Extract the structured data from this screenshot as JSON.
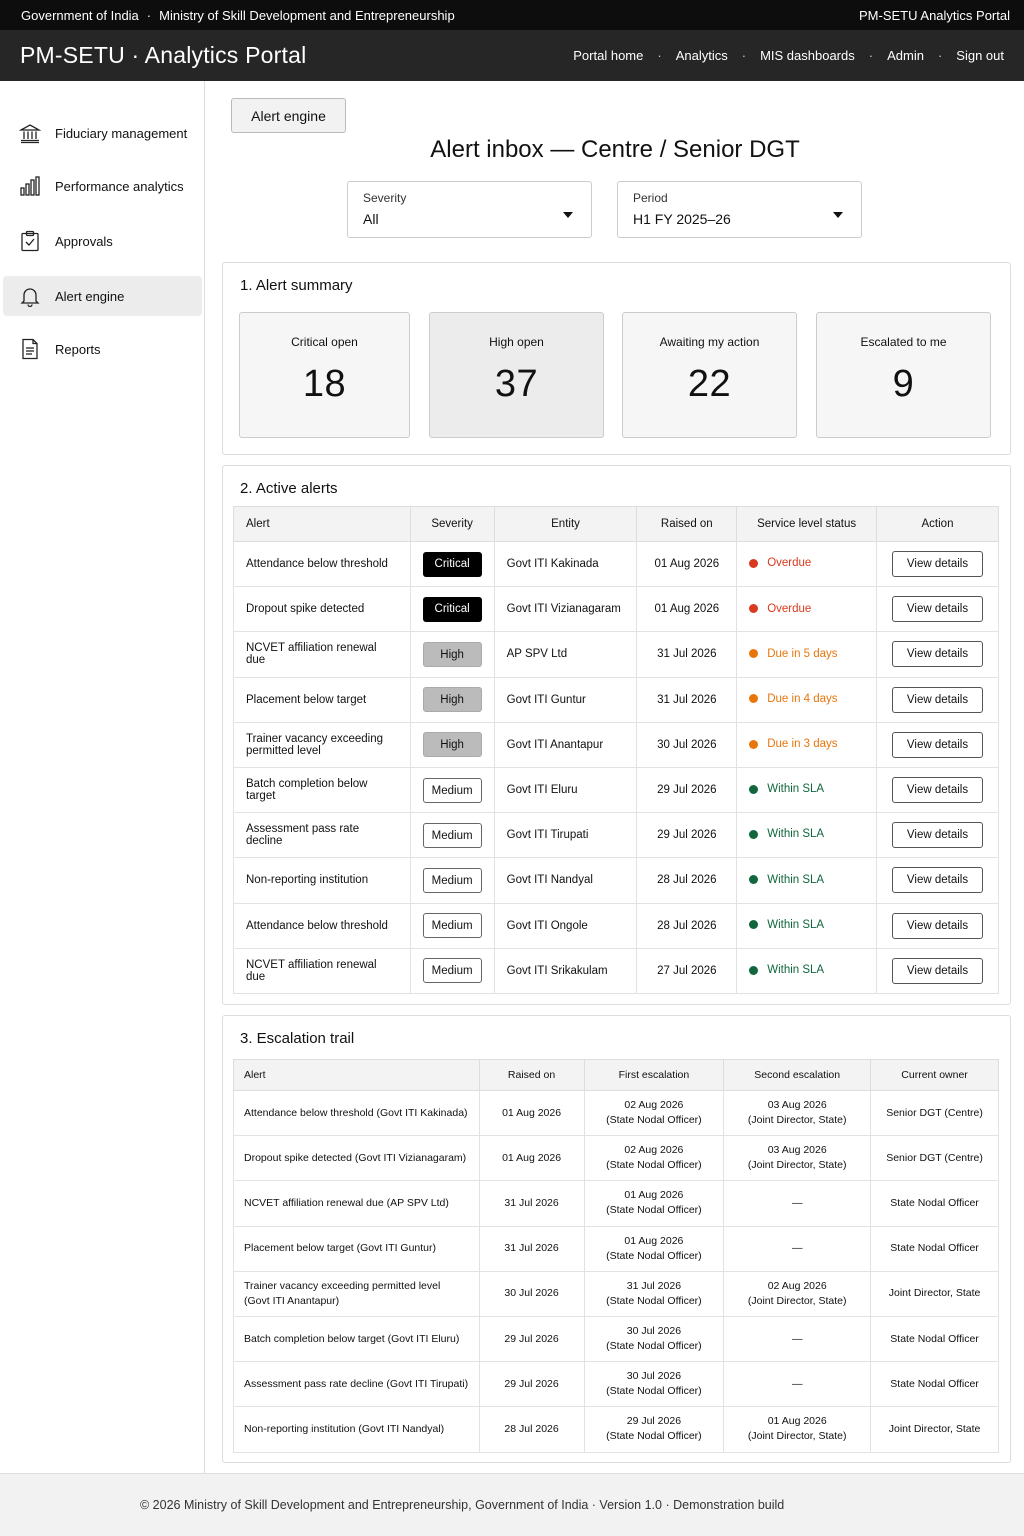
{
  "topbar": {
    "gov": "Government of India",
    "sep": "·",
    "ministry": "Ministry of Skill Development and Entrepreneurship",
    "right": "PM-SETU Analytics Portal"
  },
  "header": {
    "brand": "PM-SETU · Analytics Portal",
    "nav": [
      "Portal home",
      "Analytics",
      "MIS dashboards",
      "Admin",
      "Sign out"
    ],
    "nav_sep": "·"
  },
  "sidebar": {
    "items": [
      {
        "label": "Fiduciary management",
        "icon": "bank-icon"
      },
      {
        "label": "Performance analytics",
        "icon": "bar-chart-icon"
      },
      {
        "label": "Approvals",
        "icon": "clipboard-check-icon"
      },
      {
        "label": "Alert engine",
        "icon": "bell-icon",
        "active": true
      },
      {
        "label": "Reports",
        "icon": "document-icon"
      }
    ]
  },
  "main": {
    "button": "Alert engine",
    "title": "Alert inbox — Centre / Senior DGT",
    "filters": {
      "severity": {
        "label": "Severity",
        "value": "All"
      },
      "period": {
        "label": "Period",
        "value": "H1 FY 2025–26"
      }
    }
  },
  "summary": {
    "heading": "1.  Alert summary",
    "cards": [
      {
        "label": "Critical open",
        "value": "18"
      },
      {
        "label": "High open",
        "value": "37"
      },
      {
        "label": "Awaiting my action",
        "value": "22"
      },
      {
        "label": "Escalated to me",
        "value": "9"
      }
    ]
  },
  "active": {
    "heading": "2.  Active alerts",
    "columns": [
      "Alert",
      "Severity",
      "Entity",
      "Raised on",
      "Service level status",
      "Action"
    ],
    "action_label": "View details",
    "rows": [
      {
        "alert": "Attendance below threshold",
        "severity": "Critical",
        "entity": "Govt ITI Kakinada",
        "raised": "01 Aug 2026",
        "sla": "Overdue",
        "level": "overdue"
      },
      {
        "alert": "Dropout spike detected",
        "severity": "Critical",
        "entity": "Govt ITI Vizianagaram",
        "raised": "01 Aug 2026",
        "sla": "Overdue",
        "level": "overdue"
      },
      {
        "alert": "NCVET affiliation renewal due",
        "severity": "High",
        "entity": "AP SPV Ltd",
        "raised": "31 Jul 2026",
        "sla": "Due in 5 days",
        "level": "due"
      },
      {
        "alert": "Placement below target",
        "severity": "High",
        "entity": "Govt ITI Guntur",
        "raised": "31 Jul 2026",
        "sla": "Due in 4 days",
        "level": "due"
      },
      {
        "alert": "Trainer vacancy exceeding permitted level",
        "severity": "High",
        "entity": "Govt ITI Anantapur",
        "raised": "30 Jul 2026",
        "sla": "Due in 3 days",
        "level": "due"
      },
      {
        "alert": "Batch completion below target",
        "severity": "Medium",
        "entity": "Govt ITI Eluru",
        "raised": "29 Jul 2026",
        "sla": "Within SLA",
        "level": "ok"
      },
      {
        "alert": "Assessment pass rate decline",
        "severity": "Medium",
        "entity": "Govt ITI Tirupati",
        "raised": "29 Jul 2026",
        "sla": "Within SLA",
        "level": "ok"
      },
      {
        "alert": "Non-reporting institution",
        "severity": "Medium",
        "entity": "Govt ITI Nandyal",
        "raised": "28 Jul 2026",
        "sla": "Within SLA",
        "level": "ok"
      },
      {
        "alert": "Attendance below threshold",
        "severity": "Medium",
        "entity": "Govt ITI Ongole",
        "raised": "28 Jul 2026",
        "sla": "Within SLA",
        "level": "ok"
      },
      {
        "alert": "NCVET affiliation renewal due",
        "severity": "Medium",
        "entity": "Govt ITI Srikakulam",
        "raised": "27 Jul 2026",
        "sla": "Within SLA",
        "level": "ok"
      }
    ]
  },
  "escalation": {
    "heading": "3.  Escalation trail",
    "columns": [
      "Alert",
      "Raised on",
      "First escalation",
      "Second escalation",
      "Current owner"
    ],
    "rows": [
      {
        "alert": "Attendance below threshold (Govt ITI Kakinada)",
        "raised": "01 Aug 2026",
        "first_date": "02 Aug 2026",
        "first_role": "(State Nodal Officer)",
        "second_date": "03 Aug 2026",
        "second_role": "(Joint Director, State)",
        "owner": "Senior DGT (Centre)"
      },
      {
        "alert": "Dropout spike detected (Govt ITI Vizianagaram)",
        "raised": "01 Aug 2026",
        "first_date": "02 Aug 2026",
        "first_role": "(State Nodal Officer)",
        "second_date": "03 Aug 2026",
        "second_role": "(Joint Director, State)",
        "owner": "Senior DGT (Centre)"
      },
      {
        "alert": "NCVET affiliation renewal due (AP SPV Ltd)",
        "raised": "31 Jul 2026",
        "first_date": "01 Aug 2026",
        "first_role": "(State Nodal Officer)",
        "second_date": "—",
        "second_role": "",
        "owner": "State Nodal Officer"
      },
      {
        "alert": "Placement below target (Govt ITI Guntur)",
        "raised": "31 Jul 2026",
        "first_date": "01 Aug 2026",
        "first_role": "(State Nodal Officer)",
        "second_date": "—",
        "second_role": "",
        "owner": "State Nodal Officer"
      },
      {
        "alert": "Trainer vacancy exceeding permitted level (Govt ITI Anantapur)",
        "raised": "30 Jul 2026",
        "first_date": "31 Jul 2026",
        "first_role": "(State Nodal Officer)",
        "second_date": "02 Aug 2026",
        "second_role": "(Joint Director, State)",
        "owner": "Joint Director, State"
      },
      {
        "alert": "Batch completion below target (Govt ITI Eluru)",
        "raised": "29 Jul 2026",
        "first_date": "30 Jul 2026",
        "first_role": "(State Nodal Officer)",
        "second_date": "—",
        "second_role": "",
        "owner": "State Nodal Officer"
      },
      {
        "alert": "Assessment pass rate decline (Govt ITI Tirupati)",
        "raised": "29 Jul 2026",
        "first_date": "30 Jul 2026",
        "first_role": "(State Nodal Officer)",
        "second_date": "—",
        "second_role": "",
        "owner": "State Nodal Officer"
      },
      {
        "alert": "Non-reporting institution (Govt ITI Nandyal)",
        "raised": "28 Jul 2026",
        "first_date": "29 Jul 2026",
        "first_role": "(State Nodal Officer)",
        "second_date": "01 Aug 2026",
        "second_role": "(Joint Director, State)",
        "owner": "Joint Director, State"
      }
    ]
  },
  "footer": "© 2026 Ministry of Skill Development and Entrepreneurship, Government of India  ·  Version 1.0  ·  Demonstration build",
  "colors": {
    "overdue": "#d93a1f",
    "due": "#e8760c",
    "ok": "#11663d"
  }
}
